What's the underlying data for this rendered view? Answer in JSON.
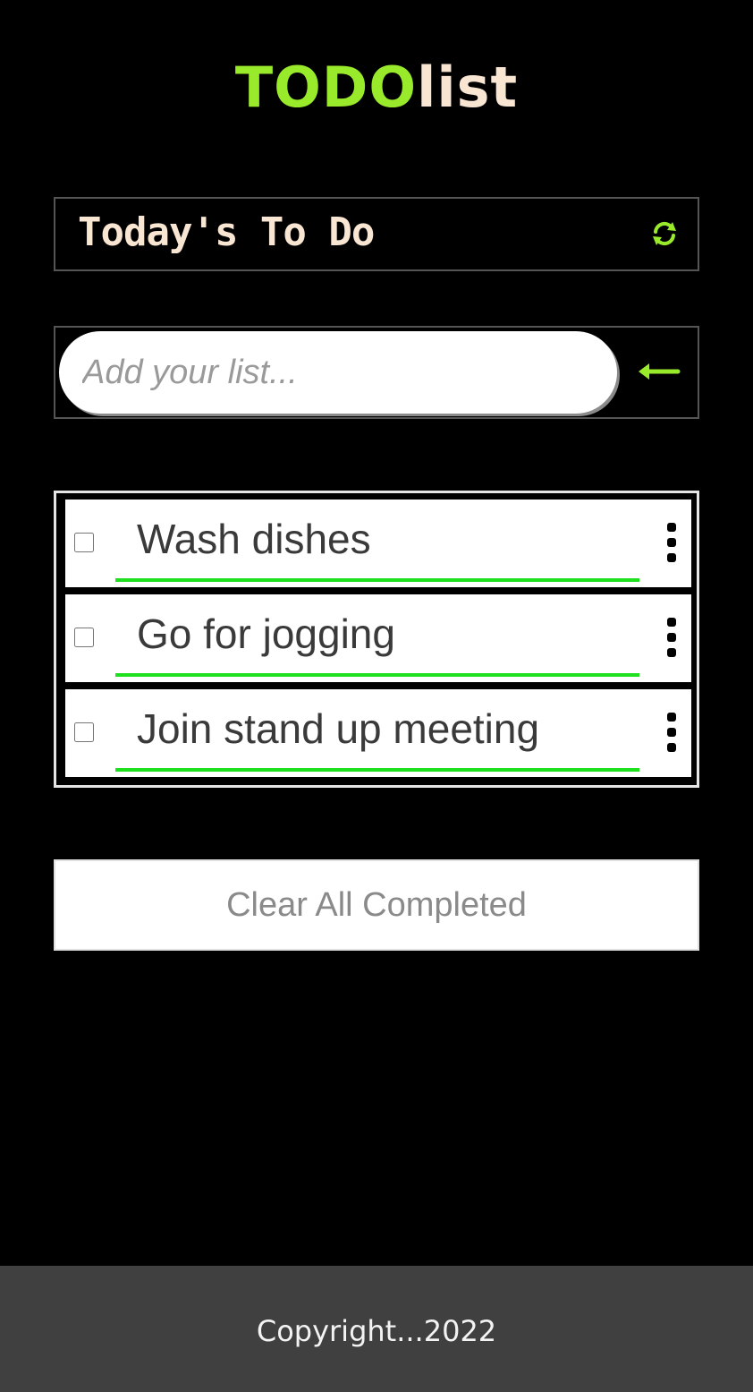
{
  "app": {
    "title_accent": "TODO",
    "title_rest": "list",
    "accent_color": "#9aea2c",
    "cream_color": "#f8e6d2"
  },
  "list_header": {
    "title": "Today's To Do",
    "refresh_icon": "refresh-icon"
  },
  "add_form": {
    "placeholder": "Add your list...",
    "value": "",
    "submit_icon": "arrow-left-icon"
  },
  "todos": [
    {
      "text": "Wash dishes",
      "completed": false
    },
    {
      "text": "Go for jogging",
      "completed": false
    },
    {
      "text": "Join stand up meeting",
      "completed": false
    }
  ],
  "actions": {
    "clear_completed_label": "Clear All Completed"
  },
  "footer": {
    "text": "Copyright...2022"
  }
}
